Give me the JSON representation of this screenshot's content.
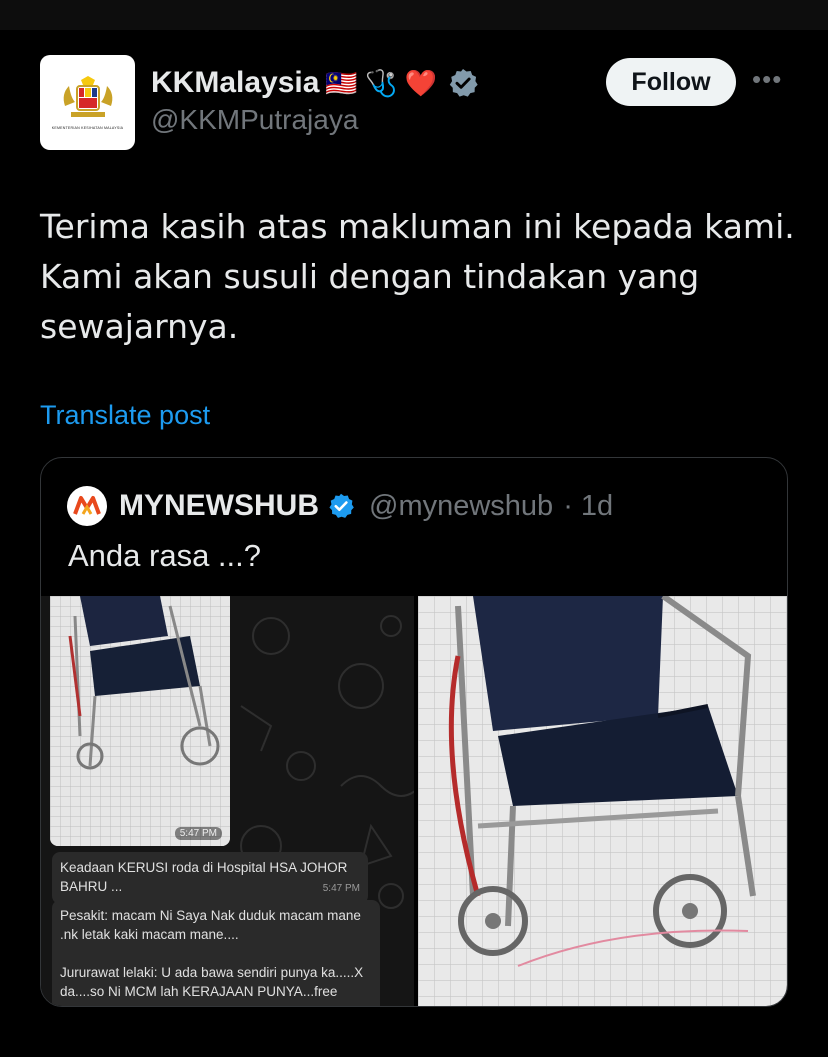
{
  "post": {
    "author_name": "KKMalaysia",
    "author_emojis": "🇲🇾 🩺 ❤️",
    "handle": "@KKMPutrajaya",
    "avatar_caption": "KEMENTERIAN KESIHATAN MALAYSIA",
    "follow_label": "Follow",
    "more_label": "•••",
    "text_lines": [
      "Terima kasih atas makluman ini kepada kami.",
      "Kami akan susuli dengan tindakan yang",
      "sewajarnya."
    ],
    "translate_label": "Translate post"
  },
  "quote": {
    "author_name": "MYNEWSHUB",
    "handle": "@mynewshub",
    "separator": "·",
    "time_ago": "1d",
    "text": "Anda rasa ...?",
    "media": {
      "photo_time": "5:47 PM",
      "bubble1_text": "Keadaan KERUSI roda di Hospital HSA JOHOR BAHRU ...",
      "bubble1_time": "5:47 PM",
      "bubble2_line1": "Pesakit: macam Ni Saya Nak duduk macam mane .nk letak kaki macam mane....",
      "bubble2_line2": "Jururawat lelaki: U ada bawa sendiri punya ka.....X da....so Ni MCM lah KERAJAAN PUNYA...free"
    }
  },
  "colors": {
    "background": "#000000",
    "text": "#e7e9ea",
    "muted": "#71767b",
    "link": "#1d9bf0",
    "verified": "#829aab",
    "verified_quote": "#1d9bf0"
  }
}
